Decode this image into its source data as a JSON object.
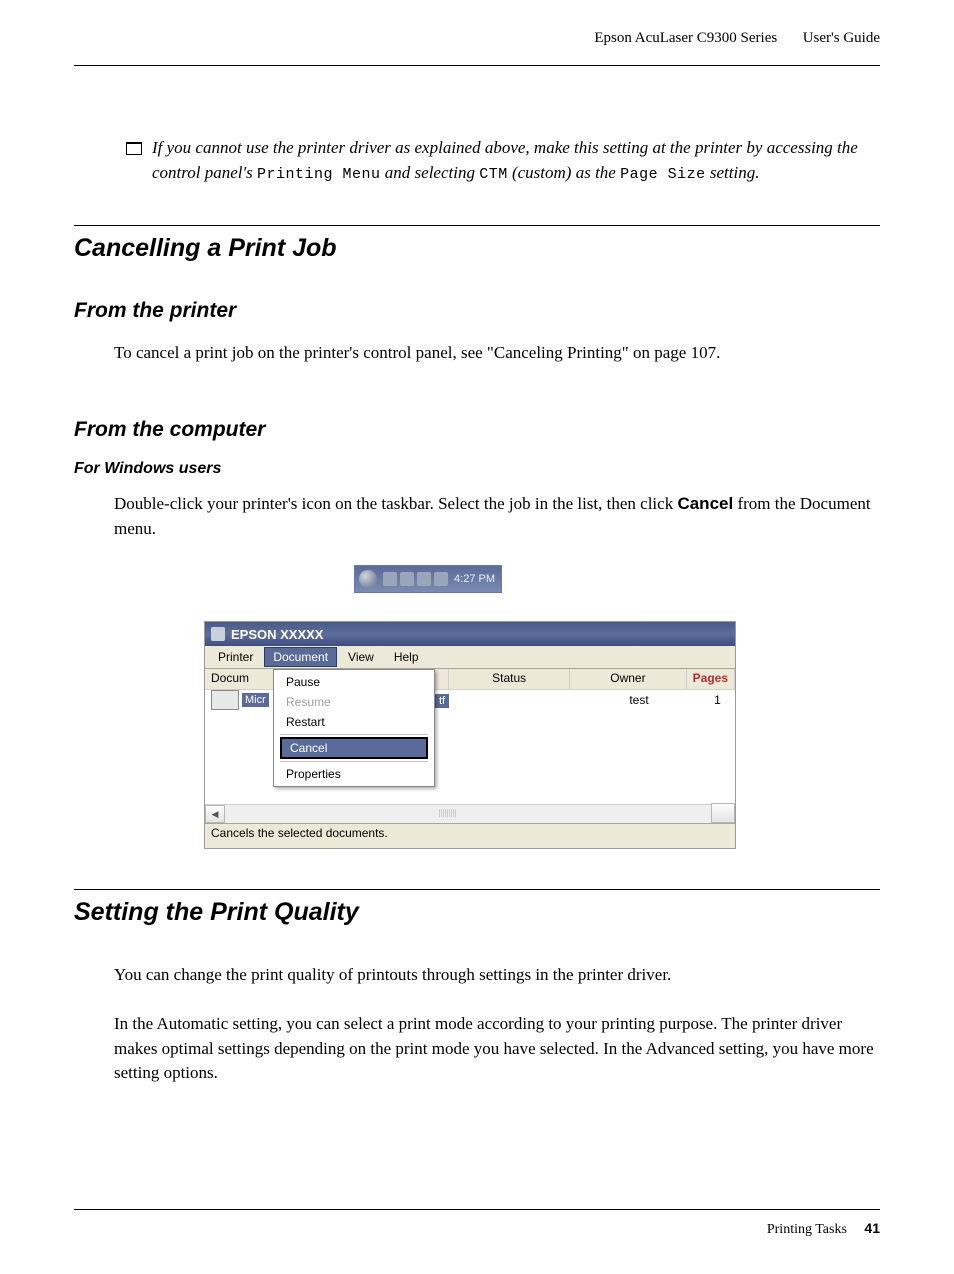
{
  "header": {
    "product": "Epson AcuLaser C9300 Series",
    "doc_type": "User's Guide"
  },
  "note": {
    "prefix": "If you cannot use the printer driver as explained above, make this setting at the printer by accessing the control panel's ",
    "mono1": "Printing Menu",
    "mid": " and selecting ",
    "mono2": "CTM",
    "mid2": " (custom) as the ",
    "mono3": "Page Size",
    "suffix": " setting."
  },
  "sections": {
    "cancel_title": "Cancelling a Print Job",
    "from_printer": "From the printer",
    "from_printer_body": "To cancel a print job on the printer's control panel, see \"Canceling Printing\" on page 107.",
    "from_computer": "From the computer",
    "for_windows": "For Windows users",
    "windows_body_1": "Double-click your printer's icon on the taskbar. Select the job in the list, then click ",
    "windows_body_bold": "Cancel",
    "windows_body_2": " from the Document menu.",
    "quality_title": "Setting the Print Quality",
    "quality_p1": "You can change the print quality of printouts through settings in the printer driver.",
    "quality_p2": "In the Automatic setting, you can select a print mode according to your printing purpose. The printer driver makes optimal settings depending on the print mode you have selected. In the Advanced setting, you have more setting options."
  },
  "tray": {
    "time": "4:27 PM"
  },
  "printer_window": {
    "title": "EPSON XXXXX",
    "menus": [
      "Printer",
      "Document",
      "View",
      "Help"
    ],
    "columns": {
      "doc": "Docum",
      "status": "Status",
      "owner": "Owner",
      "pages": "Pages"
    },
    "job": {
      "sel_label": "Micr",
      "tf": "tf",
      "owner": "test",
      "pages": "1"
    },
    "dropdown": {
      "pause": "Pause",
      "resume": "Resume",
      "restart": "Restart",
      "cancel": "Cancel",
      "properties": "Properties"
    },
    "status_text": "Cancels the selected documents."
  },
  "footer": {
    "chapter": "Printing Tasks",
    "page": "41"
  }
}
